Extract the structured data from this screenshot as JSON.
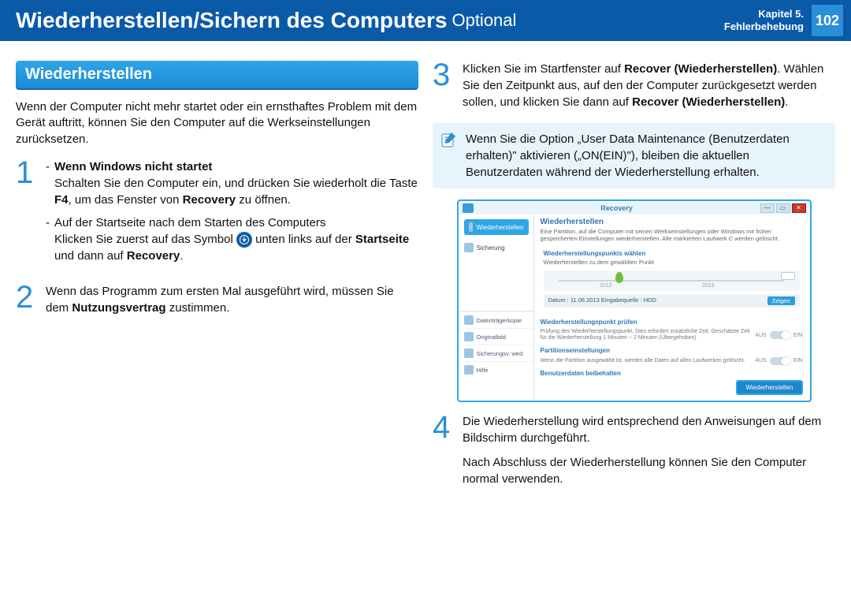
{
  "header": {
    "title": "Wiederherstellen/Sichern des Computers",
    "optional": "Optional",
    "chapter_line1": "Kapitel 5.",
    "chapter_line2": "Fehlerbehebung",
    "page_number": "102"
  },
  "section_title": "Wiederherstellen",
  "intro": "Wenn der Computer nicht mehr startet oder ein ernsthaftes Problem mit dem Gerät auftritt, können Sie den Computer auf die Werkseinstellungen zurücksetzen.",
  "step1": {
    "b1_title": "Wenn Windows nicht startet",
    "b1_text_a": "Schalten Sie den Computer ein, und drücken Sie wiederholt die Taste ",
    "b1_key": "F4",
    "b1_text_b": ", um das Fenster von ",
    "b1_recovery": "Recovery",
    "b1_text_c": " zu öffnen.",
    "b2_text": "Auf der Startseite nach dem Starten des Computers",
    "b2_line2a": "Klicken Sie zuerst auf das Symbol ",
    "b2_line2b": " unten links auf der ",
    "b2_start": "Startseite",
    "b2_line2c": " und dann auf ",
    "b2_recovery": "Recovery",
    "b2_line2d": "."
  },
  "step2": {
    "text_a": "Wenn das Programm zum ersten Mal ausgeführt wird, müssen Sie dem ",
    "bold": "Nutzungsvertrag",
    "text_b": " zustimmen."
  },
  "step3": {
    "text_a": "Klicken Sie im Startfenster auf ",
    "bold1": "Recover (Wiederherstellen)",
    "text_b": ". Wählen Sie den Zeitpunkt aus, auf den der Computer zurückgesetzt werden sollen, und klicken Sie dann auf ",
    "bold2": "Recover (Wiederherstellen)",
    "text_c": "."
  },
  "note": "Wenn Sie die Option „User Data Maintenance (Benutzerdaten erhalten)\" aktivieren („ON(EIN)\"), bleiben die aktuellen Benutzerdaten während der Wiederherstellung erhalten.",
  "step4": {
    "line1": "Die Wiederherstellung wird entsprechend den Anweisungen auf dem Bildschirm durchgeführt.",
    "line2": "Nach Abschluss der Wiederherstellung können Sie den Computer normal verwenden."
  },
  "recov_window": {
    "title": "Recovery",
    "side_active": "Wiederherstellen",
    "side_backup": "Sicherung",
    "side_lower": [
      "Datenträgerkopie",
      "Originalbild",
      "Sicherungsv. wed",
      "Hilfe"
    ],
    "main_head": "Wiederherstellen",
    "main_sub": "Eine Partition, auf die Computer mit seinen Werkseinstellungen oder Windows mit früher gespeicherten Einstellungen wiederherstellen.\nAlle markierten Laufwerk C werden gelöscht.",
    "sec1_label": "Wiederherstellungspunkts wählen",
    "sec1_sub": "Wiederherstellen zu dem gewählten Punkt",
    "year1": "2012",
    "year2": "2013",
    "date_label": "Datum : 11.06.2013     Eingabequelle : HDD",
    "view": "Zeigen",
    "sec2_label": "Wiederherstellungspunkt prüfen",
    "sec2_text": "Prüfung des Wiederherstellungspunkt. Dies erfordert zusätzliche Zeit. Geschätzte Zeit für die Wiederherstellung 1 Minuten ~ 2 Minuten (Übergehoben)",
    "sec3_label": "Partitionseinstellungen",
    "sec3_text": "Wenn die Partition ausgewählt ist, werden alle Daten auf allen Laufwerken gelöscht.",
    "sec4_label": "Benutzerdaten beibehalten",
    "aus": "AUS",
    "ein": "EIN",
    "button": "Wiederherstellen"
  }
}
